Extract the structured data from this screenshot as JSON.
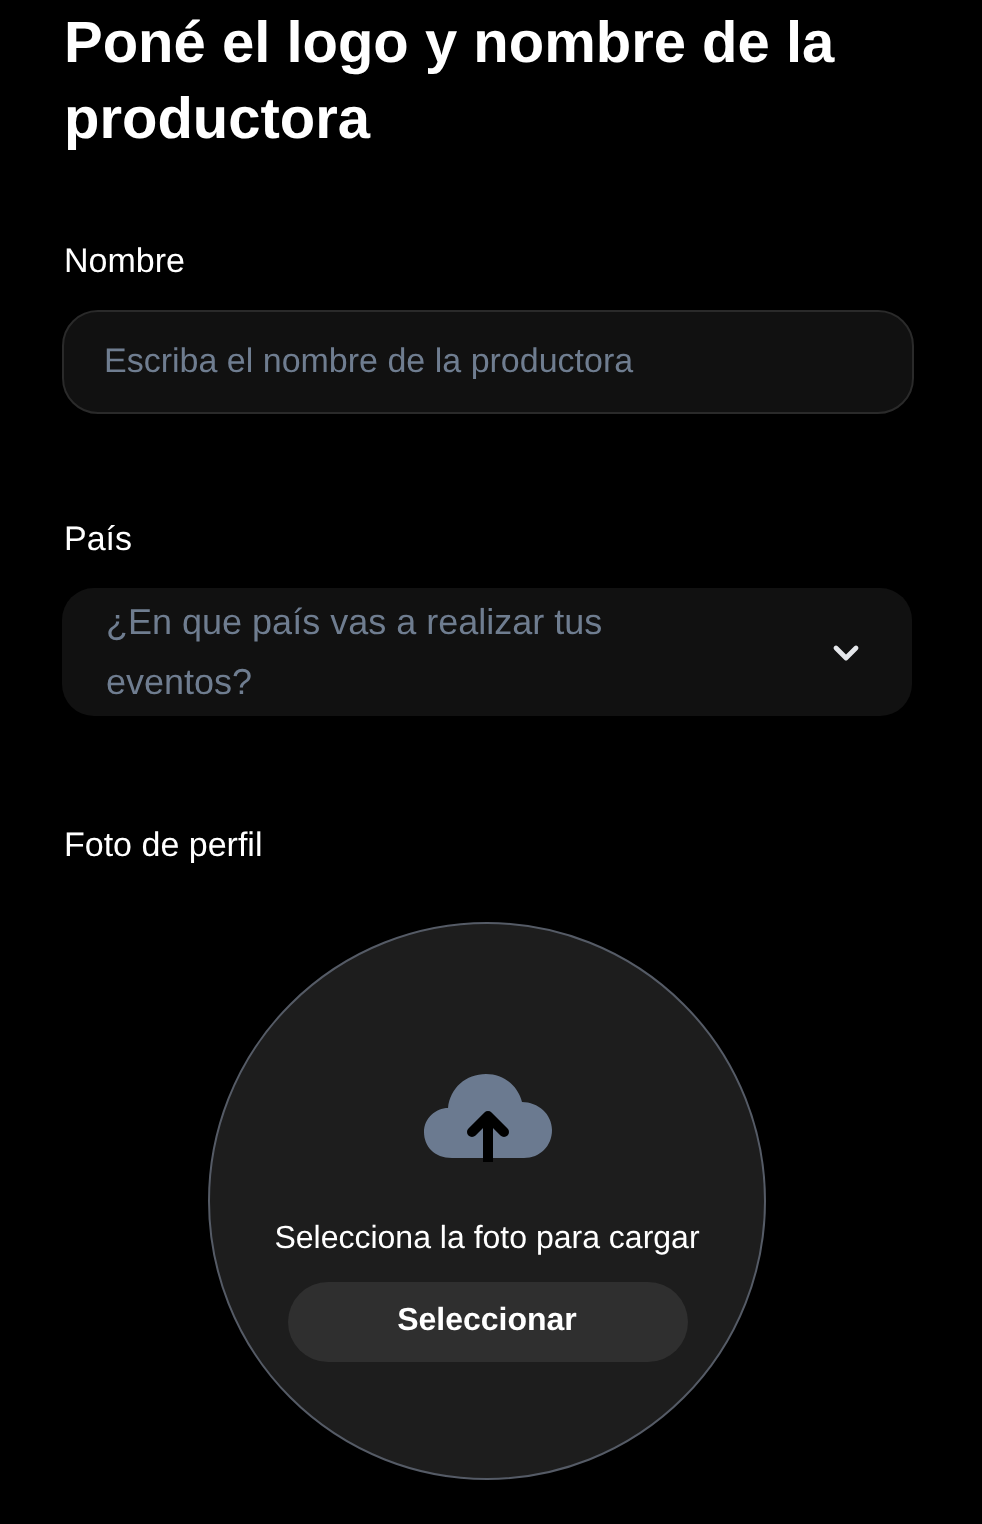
{
  "title": "Poné el logo y nombre de la productora",
  "name_field": {
    "label": "Nombre",
    "placeholder": "Escriba el nombre de la productora"
  },
  "country_field": {
    "label": "País",
    "placeholder": "¿En que país vas a realizar tus eventos?"
  },
  "photo": {
    "label": "Foto de perfil",
    "hint": "Selecciona la foto para cargar",
    "button": "Seleccionar"
  }
}
